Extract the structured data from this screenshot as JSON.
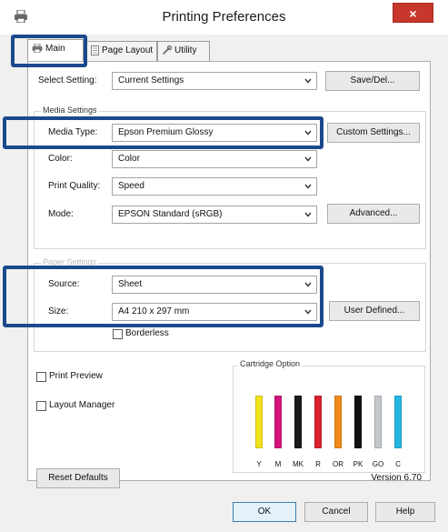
{
  "window": {
    "title": "Printing Preferences",
    "close_symbol": "×"
  },
  "tabs": [
    {
      "label": "Main"
    },
    {
      "label": "Page Layout"
    },
    {
      "label": "Utility"
    }
  ],
  "select_setting": {
    "label": "Select Setting:",
    "value": "Current Settings",
    "save_button": "Save/Del..."
  },
  "media_settings": {
    "group_title": "Media Settings",
    "media_type": {
      "label": "Media Type:",
      "value": "Epson Premium Glossy",
      "button": "Custom Settings..."
    },
    "color": {
      "label": "Color:",
      "value": "Color"
    },
    "print_quality": {
      "label": "Print Quality:",
      "value": "Speed"
    },
    "mode": {
      "label": "Mode:",
      "value": "EPSON Standard (sRGB)",
      "button": "Advanced..."
    }
  },
  "paper_settings": {
    "group_title": "Paper Settings",
    "source": {
      "label": "Source:",
      "value": "Sheet"
    },
    "size": {
      "label": "Size:",
      "value": "A4 210 x 297 mm",
      "button": "User Defined..."
    },
    "borderless": {
      "label": "Borderless",
      "checked": false
    }
  },
  "print_preview": {
    "label": "Print Preview",
    "checked": false
  },
  "layout_manager": {
    "label": "Layout Manager",
    "checked": false
  },
  "cartridge": {
    "title": "Cartridge Option",
    "inks": [
      {
        "label": "Y",
        "color": "#f2e21a"
      },
      {
        "label": "M",
        "color": "#d4147d"
      },
      {
        "label": "MK",
        "color": "#1a1a1a"
      },
      {
        "label": "R",
        "color": "#d8202e"
      },
      {
        "label": "OR",
        "color": "#f08a1c"
      },
      {
        "label": "PK",
        "color": "#111111"
      },
      {
        "label": "GO",
        "color": "#c4c8cc"
      },
      {
        "label": "C",
        "color": "#25b6e0"
      }
    ]
  },
  "footer": {
    "reset_button": "Reset Defaults",
    "version": "Version 6.70",
    "ok_button": "OK",
    "cancel_button": "Cancel",
    "help_button": "Help"
  },
  "colors": {
    "highlight": "#1a4a8c",
    "close_button": "#c7372c"
  }
}
